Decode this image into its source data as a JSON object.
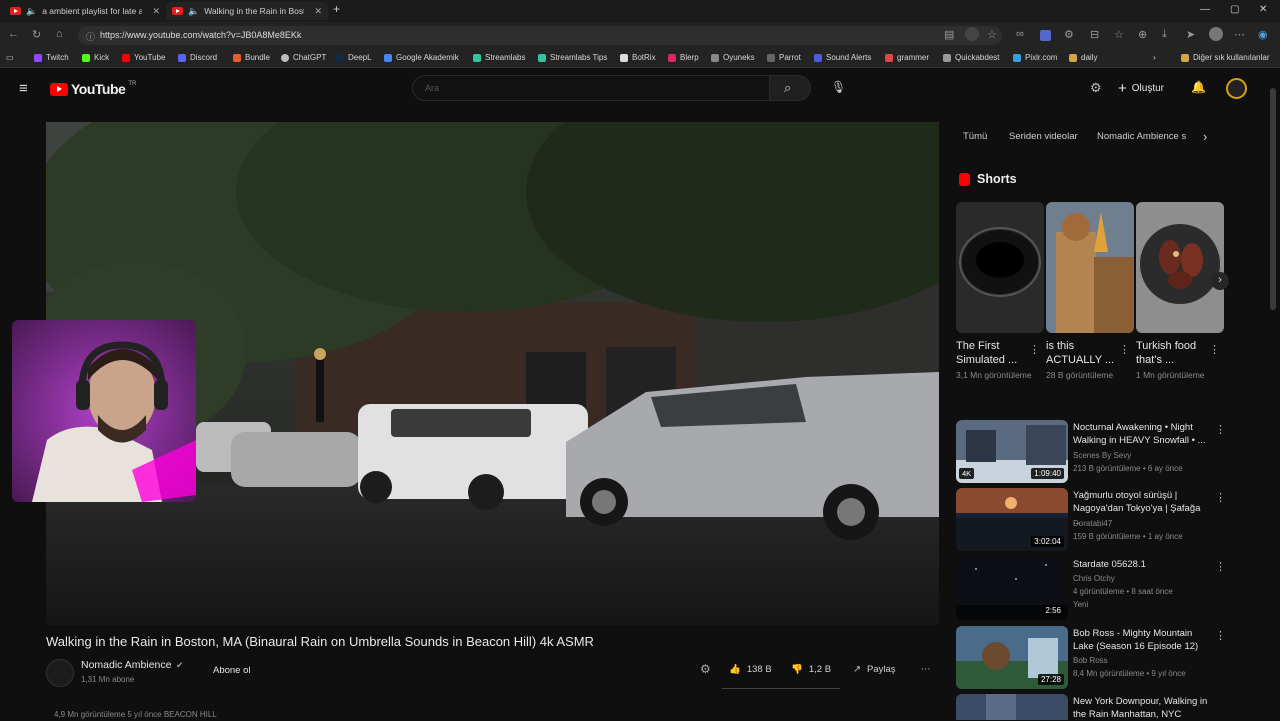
{
  "browser": {
    "tabs": [
      {
        "label": "a ambient playlist for late ar"
      },
      {
        "label": "Walking in the Rain in Boston"
      }
    ],
    "url": "https://www.youtube.com/watch?v=JB0A8Me8EKk",
    "bookmarks": [
      "Twitch",
      "Kick",
      "YouTube",
      "Discord",
      "Bundle",
      "ChatGPT",
      "DeepL",
      "Google Akademik",
      "Streamlabs",
      "Streamlabs Tips",
      "BotRix",
      "Blerp",
      "Oyuneks",
      "Parrot",
      "Sound Alerts",
      "grammer",
      "Quickabdest",
      "Pixlr.com",
      "daily"
    ],
    "other_bookmarks": "Diğer sık kullanılanlar"
  },
  "youtube": {
    "logo_text": "YouTube",
    "logo_region": "TR",
    "search_placeholder": "Ara",
    "create_label": "Oluştur"
  },
  "video": {
    "title": "Walking in the Rain in Boston, MA (Binaural Rain on Umbrella Sounds in Beacon Hill) 4k ASMR",
    "channel": "Nomadic Ambience",
    "subscribers": "1,31 Mn abone",
    "subscribe_label": "Abone ol",
    "likes": "138 B",
    "dislikes": "1,2 B",
    "share_label": "Paylaş",
    "stats_line": "4,9 Mn görüntüleme  5 yıl önce  BEACON HILL"
  },
  "filters": [
    "Tümü",
    "Seriden videolar",
    "Nomadic Ambience s"
  ],
  "shorts": {
    "header": "Shorts",
    "items": [
      {
        "title": "The First Simulated ...",
        "views": "3,1 Mn görüntüleme"
      },
      {
        "title": "is this ACTUALLY ...",
        "views": "28 B görüntüleme"
      },
      {
        "title": "Turkish food that's ...",
        "views": "1 Mn görüntüleme"
      }
    ]
  },
  "related": [
    {
      "title": "Nocturnal Awakening • Night Walking in HEAVY Snowfall • ...",
      "channel": "Scenes By Sevy",
      "meta": "213 B görüntüleme • 6 ay önce",
      "duration": "1:09:40",
      "badge": "4K"
    },
    {
      "title": "Yağmurlu otoyol sürüşü | Nagoya'dan Tokyo'ya | Şafağa ...",
      "channel": "Doratabi47",
      "meta": "159 B görüntüleme • 1 ay önce",
      "duration": "3:02:04"
    },
    {
      "title": "Stardate 05628.1",
      "channel": "Chris Otchy",
      "meta": "4 görüntüleme • 8 saat önce",
      "extra": "Yeni",
      "duration": "2:56"
    },
    {
      "title": "Bob Ross - Mighty Mountain Lake (Season 16 Episode 12)",
      "channel": "Bob Ross",
      "meta": "8,4 Mn görüntüleme • 9 yıl önce",
      "duration": "27:28"
    },
    {
      "title": "New York Downpour, Walking in the Rain Manhattan, NYC",
      "channel": "",
      "meta": "",
      "duration": ""
    }
  ],
  "colors": {
    "yt_red": "#ff0000",
    "bg": "#0f0f0f"
  }
}
